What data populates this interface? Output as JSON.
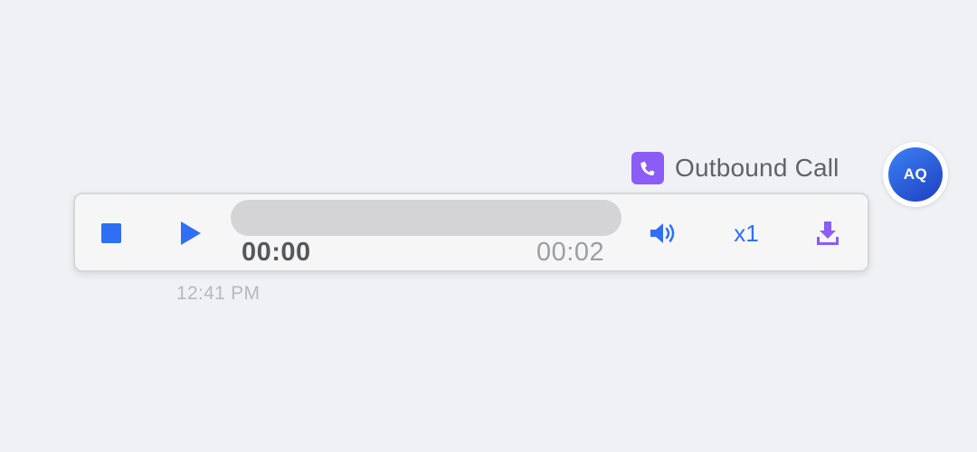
{
  "call": {
    "label": "Outbound Call",
    "icon": "phone-icon",
    "accent_color": "#8b5cf6"
  },
  "avatar": {
    "initials": "AQ"
  },
  "player": {
    "current_time": "00:00",
    "total_time": "00:02",
    "speed_label": "x1",
    "progress_fraction": 0,
    "accent_color": "#2f6ff5",
    "icons": {
      "stop": "stop-icon",
      "play": "play-icon",
      "volume": "volume-icon",
      "download": "download-icon"
    }
  },
  "message": {
    "timestamp": "12:41 PM"
  }
}
